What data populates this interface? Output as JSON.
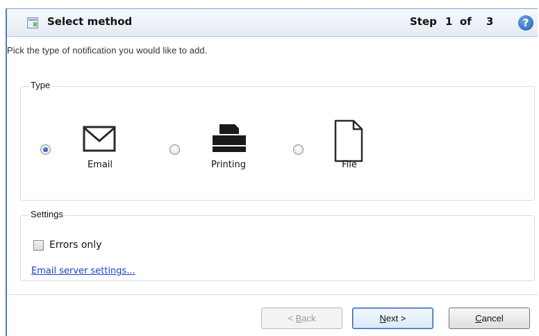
{
  "title_bar": {
    "title": "Select method",
    "step_word": "Step",
    "step_current": "1",
    "step_of": "of",
    "step_total": "3",
    "help_glyph": "?"
  },
  "subtitle": "Pick the type of notification you would like to add.",
  "type_group": {
    "label": "Type",
    "options": [
      {
        "label": "Email",
        "icon": "envelope-icon",
        "selected": true
      },
      {
        "label": "Printing",
        "icon": "printer-icon",
        "selected": false
      },
      {
        "label": "File",
        "icon": "file-icon",
        "selected": false
      }
    ]
  },
  "settings_group": {
    "label": "Settings",
    "errors_only_label": "Errors only",
    "errors_only_checked": false,
    "email_server_link": "Email server settings..."
  },
  "buttons": {
    "back_prefix": "< ",
    "back_mnemonic": "B",
    "back_rest": "ack",
    "back_enabled": false,
    "next_mnemonic": "N",
    "next_rest": "ext >",
    "cancel_mnemonic": "C",
    "cancel_rest": "ancel"
  },
  "colors": {
    "accent": "#1e5fb3",
    "link": "#1a3fcf",
    "border": "#4a7fb5"
  }
}
